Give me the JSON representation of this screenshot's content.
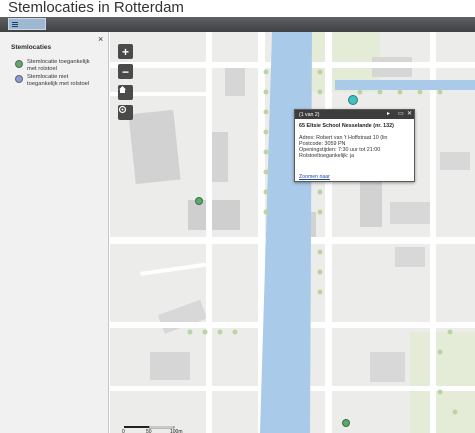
{
  "app": {
    "title": "Stemlocaties in Rotterdam"
  },
  "toolbar": {
    "list_button_label": "☰"
  },
  "legend": {
    "title": "Stemlocaties",
    "close_label": "×",
    "items": [
      {
        "label": "Stemlocatie toegankelijk met rolstoel",
        "color": "#5aa86a"
      },
      {
        "label": "Stemlocatie niet toegankelijk met rolstoel",
        "color": "#8a9ae0"
      }
    ]
  },
  "map_controls": {
    "zoom_in": "+",
    "zoom_out": "−",
    "home_icon": "home-icon",
    "locate_icon": "locate-icon"
  },
  "popup": {
    "counter": "(1 van 2)",
    "title": "65 Eltsie School Nesselande (nr. 132)",
    "address": "Adres: Robert van 't Hoffstraat 10 (lin",
    "postcode": "Postcode: 3059 PN",
    "hours": "Openingstijden: 7:30 uur tot 21:00",
    "accessible": "Rolstoeltoegankelijk: ja",
    "zoom_link": "Zoomen naar"
  },
  "scale": {
    "labels": [
      "0",
      "50",
      "100m"
    ]
  },
  "colors": {
    "water": "#a9cbe9",
    "road": "#ffffff",
    "building": "#d2d2d2",
    "park": "#dfe9cf",
    "marker_green": "#5aa86a",
    "marker_cyan": "#3fc2c0"
  }
}
